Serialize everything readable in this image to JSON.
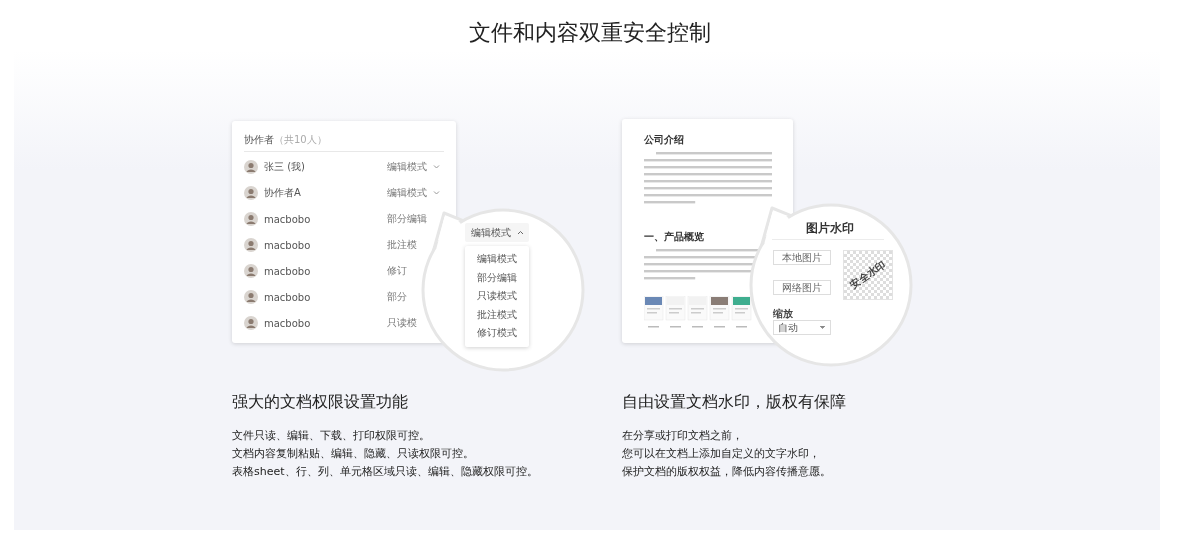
{
  "title": "文件和内容双重安全控制",
  "features": [
    {
      "kind": "permissions",
      "heading": "强大的文档权限设置功能",
      "lines": [
        "文件只读、编辑、下载、打印权限可控。",
        "文档内容复制粘贴、编辑、隐藏、只读权限可控。",
        "表格sheet、行、列、单元格区域只读、编辑、隐藏权限可控。"
      ],
      "panel": {
        "title": "协作者",
        "count": "（共10人）",
        "members": [
          {
            "name": "张三 (我)",
            "mode": "编辑模式",
            "dropdown": true
          },
          {
            "name": "协作者A",
            "mode": "编辑模式",
            "dropdown": true
          },
          {
            "name": "macbobo",
            "mode": "部分编辑",
            "dropdown": false
          },
          {
            "name": "macbobo",
            "mode": "批注模",
            "dropdown": false
          },
          {
            "name": "macbobo",
            "mode": "修订",
            "dropdown": false
          },
          {
            "name": "macbobo",
            "mode": "部分",
            "dropdown": false
          },
          {
            "name": "macbobo",
            "mode": "只读模",
            "dropdown": false
          }
        ]
      },
      "zoom": {
        "current": "编辑模式",
        "expanded": true,
        "options": [
          "编辑模式",
          "部分编辑",
          "只读模式",
          "批注模式",
          "修订模式"
        ]
      }
    },
    {
      "kind": "watermark",
      "heading": "自由设置文档水印，版权有保障",
      "lines": [
        "在分享或打印文档之前，",
        "您可以在文档上添加自定义的文字水印，",
        "保护文档的版权权益，降低内容传播意愿。"
      ],
      "document": {
        "sections": [
          {
            "heading": "公司介绍"
          },
          {
            "heading": "一、产品概览"
          }
        ]
      },
      "zoom": {
        "title": "图片水印",
        "buttons": [
          "本地图片",
          "网络图片"
        ],
        "preview": "安全水印",
        "scale_label": "缩放",
        "scale_value": "自动"
      }
    }
  ]
}
